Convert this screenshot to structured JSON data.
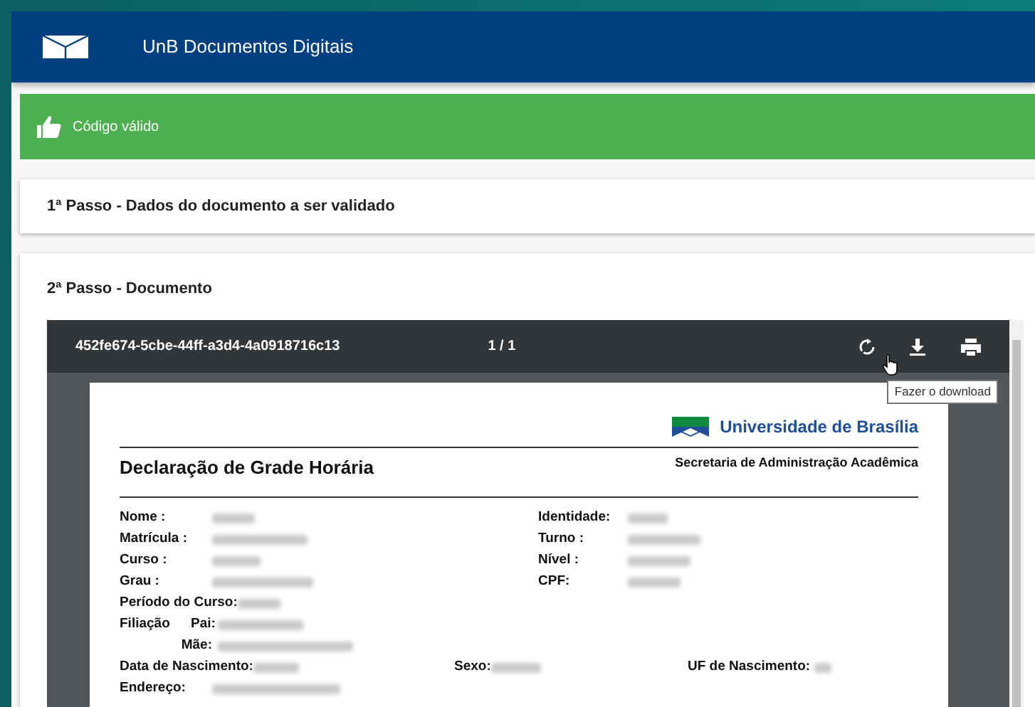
{
  "header": {
    "title": "UnB Documentos Digitais"
  },
  "alert": {
    "text": "Código válido"
  },
  "steps": [
    {
      "title": "1ª Passo - Dados do documento a ser validado"
    },
    {
      "title": "2ª Passo - Documento"
    }
  ],
  "viewer": {
    "file_name": "452fe674-5cbe-44ff-a3d4-4a0918716c13",
    "page_count": "1 / 1",
    "tooltip": "Fazer o download",
    "document": {
      "university": "Universidade de Brasília",
      "title": "Declaração de Grade Horária",
      "office": "Secretaria de Administração Acadêmica",
      "lines": [
        {
          "kind": "pair",
          "labels": [
            "Nome :",
            "Identidade:"
          ]
        },
        {
          "kind": "pair",
          "labels": [
            "Matrícula :",
            "Turno :"
          ]
        },
        {
          "kind": "pair",
          "labels": [
            "Curso :",
            "Nível :"
          ]
        },
        {
          "kind": "pair",
          "labels": [
            "Grau :",
            "CPF:"
          ]
        },
        {
          "kind": "inline",
          "labels": [
            "Período do Curso:"
          ]
        },
        {
          "kind": "parent",
          "labels": [
            "Filiação",
            "Pai:"
          ]
        },
        {
          "kind": "parent",
          "labels": [
            "Mãe:"
          ]
        },
        {
          "kind": "triple",
          "labels": [
            "Data de Nascimento:",
            "Sexo:",
            "UF de Nascimento:"
          ]
        },
        {
          "kind": "address",
          "labels": [
            "Endereço:"
          ]
        }
      ]
    }
  }
}
